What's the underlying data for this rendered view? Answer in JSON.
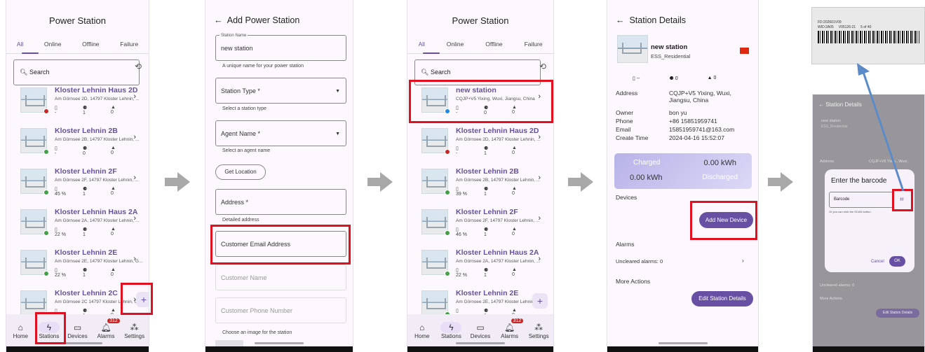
{
  "p1": {
    "title": "Power Station",
    "tabs": [
      "All",
      "Online",
      "Offline",
      "Failure"
    ],
    "search": "Search",
    "stations": [
      {
        "name": "Kloster Lehnin Haus 2D",
        "addr": "Am Görnsee 2D, 14797 Kloster Lehnin, ...",
        "s1": "-",
        "s2": "1",
        "s3": "0",
        "dot": "#c62828"
      },
      {
        "name": "Kloster Lehnin 2B",
        "addr": "Am Görnsee 2B, 14797 Kloster Lehnin, ...",
        "s1": "-",
        "s2": "0",
        "s3": "0",
        "dot": "#43a047"
      },
      {
        "name": "Kloster Lehnin 2F",
        "addr": "Am Görnsee 2F, 14797 Kloster Lehnin, ...",
        "s1": "45 %",
        "s2": "1",
        "s3": "0",
        "dot": "#43a047"
      },
      {
        "name": "Kloster Lehnin Haus 2A",
        "addr": "Am Görnsee 2A, 14797 Kloster Lehnin, ...",
        "s1": "22 %",
        "s2": "1",
        "s3": "0",
        "dot": "#43a047"
      },
      {
        "name": "Kloster Lehnin 2E",
        "addr": "Am Görnsee 2E, 14797 Kloster Lehnin, G...",
        "s1": "22 %",
        "s2": "1",
        "s3": "0",
        "dot": "#43a047"
      },
      {
        "name": "Kloster Lehnin 2C",
        "addr": "Am Görnsee 2C 14797 Kloster Lehnin, G...",
        "s1": "-",
        "s2": "1",
        "s3": "0",
        "dot": "#43a047"
      }
    ],
    "nav": [
      "Home",
      "Stations",
      "Devices",
      "Alarms",
      "Settings"
    ],
    "badge": "312",
    "fab": "+"
  },
  "p2": {
    "title": "Add Power Station",
    "name_label": "Station Name",
    "name_value": "new station",
    "name_helper": "A unique name for your power station",
    "type_label": "Station Type *",
    "type_helper": "Select a station type",
    "agent_label": "Agent Name *",
    "agent_helper": "Select an agent name",
    "get_location": "Get Location",
    "address_label": "Address *",
    "address_helper": "Detailed address",
    "email": "Customer Email Address",
    "cust_name": "Customer Name",
    "cust_phone": "Customer Phone Number",
    "image_hint": "Choose an image for the station"
  },
  "p3": {
    "title": "Power Station",
    "tabs": [
      "All",
      "Online",
      "Offline",
      "Failure"
    ],
    "search": "Search",
    "stations": [
      {
        "name": "new station",
        "addr": "CQJP+V5 Yixing, Wuxi, Jiangsu, China",
        "s1": "-",
        "s2": "0",
        "s3": "0",
        "dot": "#1e88e5"
      },
      {
        "name": "Kloster Lehnin Haus 2D",
        "addr": "Am Görnsee 2D, 14797 Kloster Lehnin, ...",
        "s1": "-",
        "s2": "1",
        "s3": "0",
        "dot": "#c62828"
      },
      {
        "name": "Kloster Lehnin 2B",
        "addr": "Am Görnsee 2B, 14797 Kloster Lehnin, ...",
        "s1": "39 %",
        "s2": "1",
        "s3": "0",
        "dot": "#43a047"
      },
      {
        "name": "Kloster Lehnin 2F",
        "addr": "Am Görnsee 2F, 14797 Kloster Lehnin, ...",
        "s1": "46 %",
        "s2": "1",
        "s3": "0",
        "dot": "#43a047"
      },
      {
        "name": "Kloster Lehnin Haus 2A",
        "addr": "Am Görnsee 2A, 14797 Kloster Lehnin, ...",
        "s1": "22 %",
        "s2": "1",
        "s3": "0",
        "dot": "#43a047"
      },
      {
        "name": "Kloster Lehnin 2E",
        "addr": "Am Görnsee 2E, 14797 Kloster Lehnin, ...",
        "s1": "-",
        "s2": "1",
        "s3": "0",
        "dot": "#43a047"
      }
    ],
    "nav": [
      "Home",
      "Stations",
      "Devices",
      "Alarms",
      "Settings"
    ],
    "badge": "312",
    "fab": "+"
  },
  "p4": {
    "title": "Station Details",
    "name": "new station",
    "type": "ESS_Residential",
    "st1": "--",
    "st2": "0",
    "st3": "0",
    "rows": [
      [
        "Address",
        "CQJP+V5 Yixing, Wuxi,\nJiangsu, China"
      ],
      [
        "Owner",
        "bon yu"
      ],
      [
        "Phone",
        "+86 15851959741"
      ],
      [
        "Email",
        "15851959741@163.com"
      ],
      [
        "Create Time",
        "2024-04-16 15:52:07"
      ]
    ],
    "charged": "Charged",
    "charged_val": "0.00 kWh",
    "discharged_val": "0.00 kWh",
    "discharged": "Discharged",
    "devices": "Devices",
    "add_device": "Add New Device",
    "alarms": "Alarms",
    "uncleared": "Uncleared alarms: 0",
    "more": "More Actions",
    "edit": "Edit Station Details"
  },
  "p5": {
    "label_line1": "FD:202601V09",
    "label_line2": "WID:2A05     V05126-21     5 of 40",
    "title": "Station Details",
    "name": "new station",
    "type": "ESS_Residential",
    "addr_label": "Address",
    "addr_val": "CQJP+V5 Yixin...Wuxi,",
    "dialog_title": "Enter the barcode",
    "barcode_label": "Barcode",
    "hint": "Or you can click the SCAN button",
    "cancel": "Cancel",
    "ok": "OK",
    "uncleared": "Uncleared alarms: 0",
    "more": "More Actions",
    "edit": "Edit Station Details"
  }
}
